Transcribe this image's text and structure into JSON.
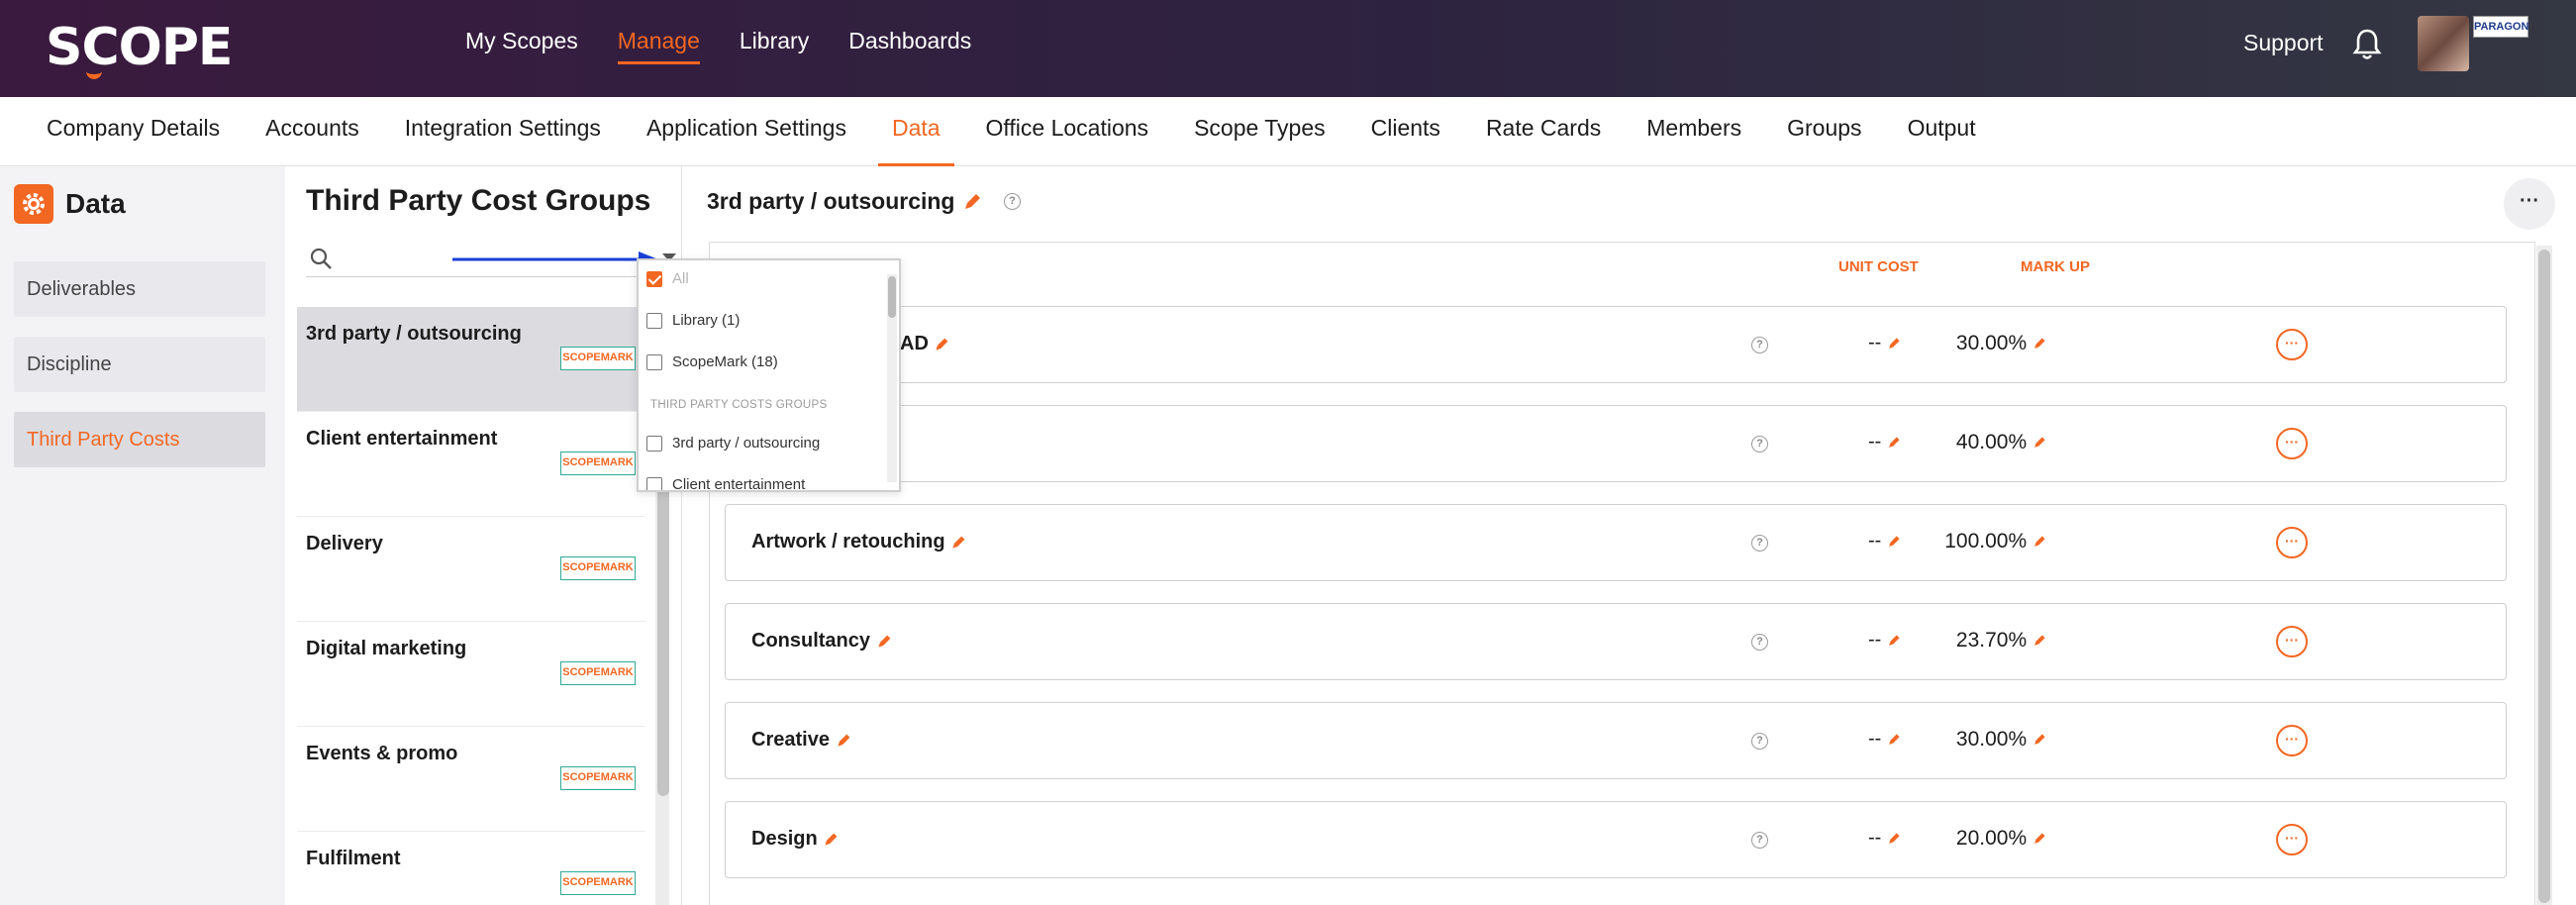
{
  "brand": {
    "logo_text": "SCOPE",
    "badge_text": "PARAGON",
    "accent": "#f26722"
  },
  "top_nav": {
    "items": [
      "My Scopes",
      "Manage",
      "Library",
      "Dashboards"
    ],
    "active": "Manage",
    "support": "Support"
  },
  "sub_nav": {
    "tabs": [
      "Company Details",
      "Accounts",
      "Integration Settings",
      "Application Settings",
      "Data",
      "Office Locations",
      "Scope Types",
      "Clients",
      "Rate Cards",
      "Members",
      "Groups",
      "Output"
    ],
    "active": "Data"
  },
  "left_panel": {
    "title": "Data",
    "items": [
      "Deliverables",
      "Discipline",
      "Third Party Costs"
    ],
    "active": "Third Party Costs"
  },
  "mid_panel": {
    "title": "Third Party Cost Groups",
    "groups": [
      {
        "name": "3rd party / outsourcing",
        "tag": "SCOPEMARK"
      },
      {
        "name": "Client entertainment",
        "tag": "SCOPEMARK"
      },
      {
        "name": "Delivery",
        "tag": "SCOPEMARK"
      },
      {
        "name": "Digital marketing",
        "tag": "SCOPEMARK"
      },
      {
        "name": "Events & promo",
        "tag": "SCOPEMARK"
      },
      {
        "name": "Fulfilment",
        "tag": "SCOPEMARK"
      }
    ]
  },
  "filter_dropdown": {
    "all_label": "All",
    "options": [
      "Library (1)",
      "ScopeMark (18)"
    ],
    "section_header": "THIRD PARTY COSTS GROUPS",
    "group_options": [
      "3rd party / outsourcing",
      "Client entertainment"
    ]
  },
  "right_panel": {
    "title": "3rd party / outsourcing",
    "columns": {
      "unit_cost": "UNIT COST",
      "mark_up": "MARK UP"
    },
    "rows": [
      {
        "name": "AD",
        "unit_cost": "--",
        "mark_up": "30.00%"
      },
      {
        "name": "",
        "unit_cost": "--",
        "mark_up": "40.00%"
      },
      {
        "name": "Artwork / retouching",
        "unit_cost": "--",
        "mark_up": "100.00%"
      },
      {
        "name": "Consultancy",
        "unit_cost": "--",
        "mark_up": "23.70%"
      },
      {
        "name": "Creative",
        "unit_cost": "--",
        "mark_up": "30.00%"
      },
      {
        "name": "Design",
        "unit_cost": "--",
        "mark_up": "20.00%"
      }
    ],
    "more_icon": "ellipsis-icon"
  }
}
